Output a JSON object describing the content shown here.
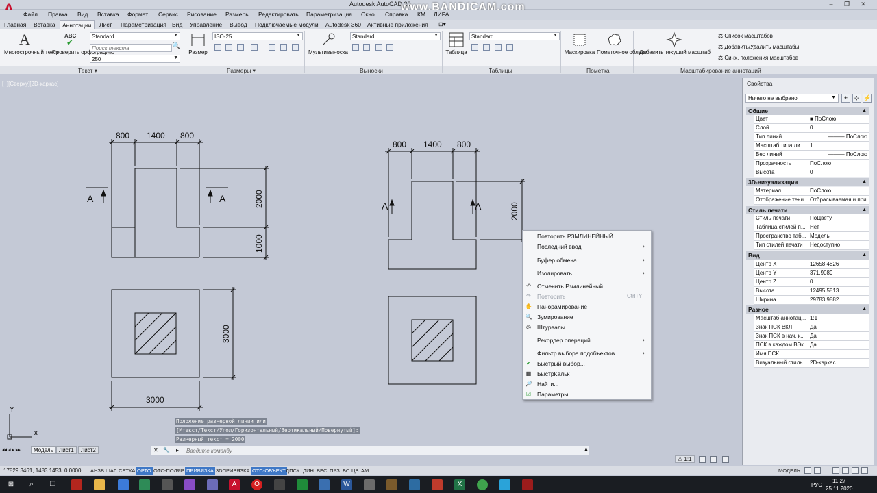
{
  "window": {
    "title": "Autodesk AutoCAD 20",
    "watermark": "www.BANDICAM.com",
    "logo": "A"
  },
  "menu": [
    "Файл",
    "Правка",
    "Вид",
    "Вставка",
    "Формат",
    "Сервис",
    "Рисование",
    "Размеры",
    "Редактировать",
    "Параметризация",
    "Окно",
    "Справка",
    "КМ",
    "ЛИРА"
  ],
  "tabs": [
    "Главная",
    "Вставка",
    "Аннотации",
    "Лист",
    "Параметризация",
    "Вид",
    "Управление",
    "Вывод",
    "Подключаемые модули",
    "Autodesk 360",
    "Активные приложения"
  ],
  "ribbon": {
    "text_panel": {
      "mtext_label": "Многострочный текст",
      "spell_label": "Проверить орфографию",
      "spell_icon_text": "ABC",
      "style": "Standard",
      "search_placeholder": "Поиск текста",
      "height": "250",
      "panel_label": "Текст ▾"
    },
    "dim_panel": {
      "dim_label": "Размер",
      "style": "ISO-25",
      "panel_label": "Размеры ▾"
    },
    "leader_panel": {
      "mleader_label": "Мультивыноска",
      "style": "Standard",
      "panel_label": "Выноски"
    },
    "table_panel": {
      "table_label": "Таблица",
      "style": "Standard",
      "panel_label": "Таблицы"
    },
    "markup_panel": {
      "wipeout_label": "Маскировка",
      "revcloud_label": "Пометочное облако",
      "panel_label": "Пометка"
    },
    "scale_panel": {
      "add_scale_label": "Добавить текущий масштаб",
      "scale_list": "Список масштабов",
      "add_remove": "Добавить/Удалить масштабы",
      "sync": "Синх. положения масштабов",
      "panel_label": "Масштабирование аннотаций"
    }
  },
  "viewport_label": "[−][Сверху][2D-каркас]",
  "drawing": {
    "left_top_dims": [
      "800",
      "1400",
      "800"
    ],
    "left_heights": [
      "2000",
      "1000"
    ],
    "right_top_dims": [
      "800",
      "1400",
      "800"
    ],
    "right_height": "2000",
    "plan_height": "3000",
    "plan_width": "3000",
    "section_mark": "A",
    "ucs_y": "Y",
    "ucs_x": "X"
  },
  "command": {
    "history": [
      "Положение размерной линии или",
      "[Мтекст/Текст/Угол/Горизонтальный/Вертикальный/Повернутый]:",
      "Размерный текст = 2000"
    ],
    "placeholder": "Введите команду"
  },
  "layout_tabs": [
    "Модель",
    "Лист1",
    "Лист2"
  ],
  "context_menu": {
    "items": [
      {
        "label": "Повторить РЗМЛИНЕЙНЫЙ"
      },
      {
        "label": "Последний ввод",
        "arrow": "›"
      },
      {
        "label": "Буфер обмена",
        "arrow": "›"
      },
      {
        "label": "Изолировать",
        "arrow": "›"
      },
      {
        "label": "Отменить Рзмлинейный"
      },
      {
        "label": "Повторить",
        "shortcut": "Ctrl+Y"
      },
      {
        "label": "Панорамирование"
      },
      {
        "label": "Зумирование"
      },
      {
        "label": "Штурвалы"
      },
      {
        "label": "Рекордер операций",
        "arrow": "›"
      },
      {
        "label": "Фильтр выбора подобъектов",
        "arrow": "›"
      },
      {
        "label": "Быстрый выбор..."
      },
      {
        "label": "БыстрКальк"
      },
      {
        "label": "Найти..."
      },
      {
        "label": "Параметры..."
      }
    ]
  },
  "properties": {
    "title": "Свойства",
    "selection": "Ничего не выбрано",
    "sections": {
      "general": "Общие",
      "viz3d": "3D-визуализация",
      "plot": "Стиль печати",
      "view": "Вид",
      "misc": "Разное"
    },
    "general_rows": [
      [
        "Цвет",
        "■ ПоСлою"
      ],
      [
        "Слой",
        "0"
      ],
      [
        "Тип линий",
        "——— ПоСлою"
      ],
      [
        "Масштаб типа ли...",
        "1"
      ],
      [
        "Вес линий",
        "——— ПоСлою"
      ],
      [
        "Прозрачность",
        "ПоСлою"
      ],
      [
        "Высота",
        "0"
      ]
    ],
    "viz_rows": [
      [
        "Материал",
        "ПоСлою"
      ],
      [
        "Отображение тени",
        "Отбрасываемая и при..."
      ]
    ],
    "plot_rows": [
      [
        "Стиль печати",
        "ПоЦвету"
      ],
      [
        "Таблица стилей п...",
        "Нет"
      ],
      [
        "Пространство таб...",
        "Модель"
      ],
      [
        "Тип стилей печати",
        "Недоступно"
      ]
    ],
    "view_rows": [
      [
        "Центр X",
        "12658.4826"
      ],
      [
        "Центр Y",
        "371.9089"
      ],
      [
        "Центр Z",
        "0"
      ],
      [
        "Высота",
        "12495.5813"
      ],
      [
        "Ширина",
        "29783.9882"
      ]
    ],
    "misc_rows": [
      [
        "Масштаб аннотац...",
        "1:1"
      ],
      [
        "Знак ПСК ВКЛ",
        "Да"
      ],
      [
        "Знак ПСК в нач. к...",
        "Да"
      ],
      [
        "ПСК в каждом ВЭк...",
        "Да"
      ],
      [
        "Имя ПСК",
        ""
      ],
      [
        "Визуальный стиль",
        "2D-каркас"
      ]
    ]
  },
  "status": {
    "coords": "17829.3461, 1483.1453, 0.0000",
    "buttons": [
      {
        "label": "АНЗВ",
        "on": false
      },
      {
        "label": "ШАГ",
        "on": false
      },
      {
        "label": "СЕТКА",
        "on": false
      },
      {
        "label": "ОРТО",
        "on": true
      },
      {
        "label": "ОТС-ПОЛЯР",
        "on": false
      },
      {
        "label": "ПРИВЯЗКА",
        "on": true
      },
      {
        "label": "3DПРИВЯЗКА",
        "on": false
      },
      {
        "label": "ОТС-ОБЪЕКТ",
        "on": true
      },
      {
        "label": "ДПСК",
        "on": false
      },
      {
        "label": "ДИН",
        "on": false
      },
      {
        "label": "ВЕС",
        "on": false
      },
      {
        "label": "ПРЗ",
        "on": false
      },
      {
        "label": "БС",
        "on": false
      },
      {
        "label": "ЦВ",
        "on": false
      },
      {
        "label": "АМ",
        "on": false
      }
    ],
    "model": "МОДЕЛЬ",
    "anno_scale": "1:1"
  },
  "taskbar": {
    "lang": "РУС",
    "time": "11:27",
    "date": "25.11.2020"
  }
}
